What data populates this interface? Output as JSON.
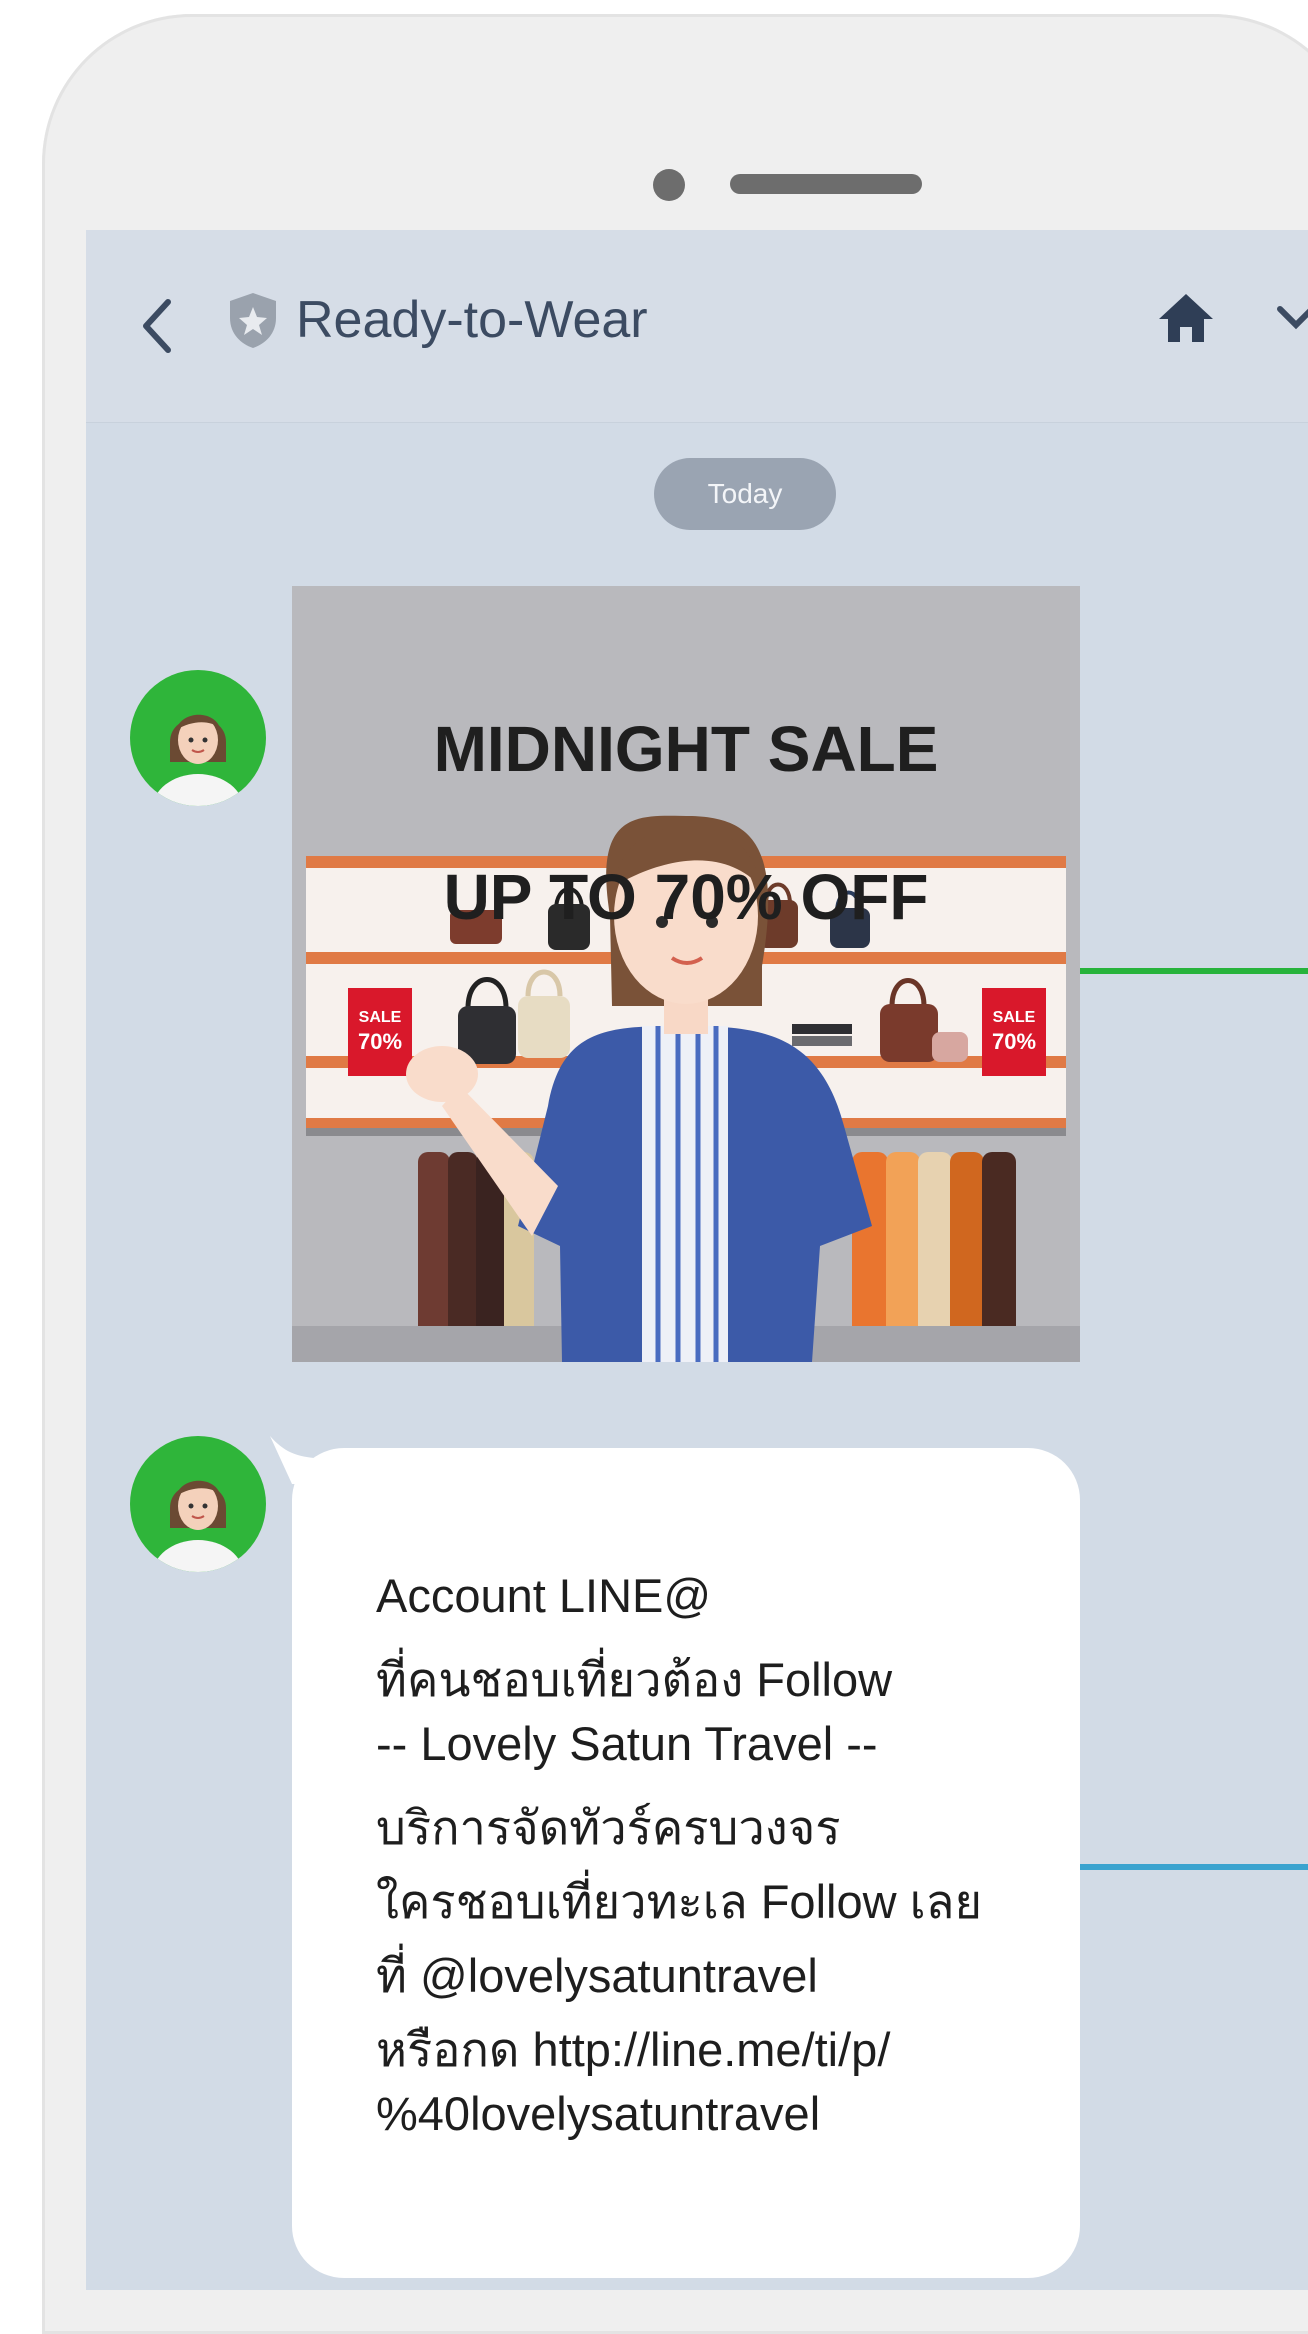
{
  "header": {
    "title": "Ready-to-Wear",
    "back_icon": "chevron-left-icon",
    "verified_icon": "shield-icon",
    "home_icon": "home-icon",
    "menu_icon": "chevron-down-icon"
  },
  "chat": {
    "date_label": "Today",
    "promo_image": {
      "title_line1": "MIDNIGHT SALE",
      "title_line2": "UP TO 70% OFF",
      "tag_text_top": "SALE",
      "tag_text_bottom": "70%"
    },
    "text_message": {
      "lines": [
        "Account LINE@",
        "ที่คนชอบเที่ยวต้อง Follow",
        "-- Lovely Satun Travel --",
        "บริการจัดทัวร์ครบวงจร",
        "ใครชอบเที่ยวทะเล Follow เลย",
        "ที่ @lovelysatuntravel",
        "หรือกด http://line.me/ti/p/",
        "%40lovelysatuntravel"
      ]
    }
  },
  "colors": {
    "chat_bg": "#d2dbe6",
    "avatar_bg": "#2fb53a",
    "accent_green": "#27b33c",
    "accent_blue": "#3aa3cf"
  }
}
